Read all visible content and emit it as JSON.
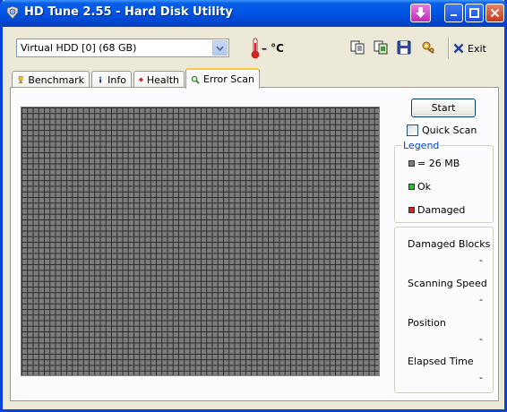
{
  "window": {
    "title": "HD Tune 2.55 - Hard Disk Utility"
  },
  "toolbar": {
    "drive": "Virtual  HDD [0] (68 GB)",
    "temperature": "– °C",
    "exit_label": "Exit"
  },
  "tabs": [
    {
      "label": "Benchmark"
    },
    {
      "label": "Info"
    },
    {
      "label": "Health"
    },
    {
      "label": "Error Scan"
    }
  ],
  "error_scan": {
    "start_label": "Start",
    "quick_scan_label": "Quick Scan",
    "quick_scan_checked": false,
    "legend": {
      "title": "Legend",
      "items": [
        {
          "label": "= 26 MB",
          "color": "#7c7c7c"
        },
        {
          "label": "Ok",
          "color": "#22c322"
        },
        {
          "label": "Damaged",
          "color": "#d81e1e"
        }
      ]
    },
    "stats": [
      {
        "label": "Damaged Blocks",
        "value": "-"
      },
      {
        "label": "Scanning Speed",
        "value": "-"
      },
      {
        "label": "Position",
        "value": "-"
      },
      {
        "label": "Elapsed Time",
        "value": "-"
      }
    ]
  }
}
